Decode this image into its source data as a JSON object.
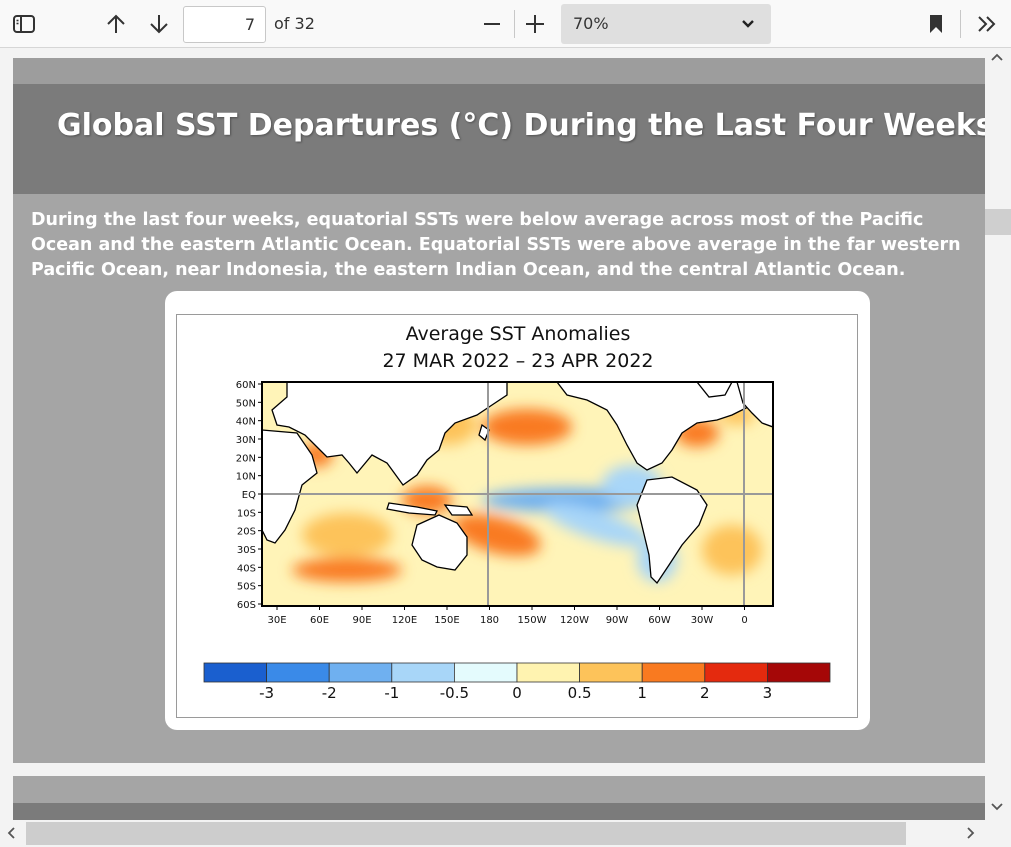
{
  "toolbar": {
    "page_current": "7",
    "page_total": "of 32",
    "zoom": "70%"
  },
  "slide": {
    "title": "Global SST Departures (°C) During the Last Four Weeks",
    "body": "During the last four weeks, equatorial SSTs were below average across most of the Pacific Ocean and the eastern Atlantic Ocean.  Equatorial SSTs were above average in the far western Pacific Ocean, near Indonesia, the eastern Indian Ocean, and the central Atlantic Ocean.",
    "map_title": "Average SST Anomalies",
    "map_dates": "27 MAR 2022 – 23 APR 2022",
    "lat_labels": [
      "60N",
      "50N",
      "40N",
      "30N",
      "20N",
      "10N",
      "EQ",
      "10S",
      "20S",
      "30S",
      "40S",
      "50S",
      "60S"
    ],
    "lon_labels": [
      "30E",
      "60E",
      "90E",
      "120E",
      "150E",
      "180",
      "150W",
      "120W",
      "90W",
      "60W",
      "30W",
      "0"
    ],
    "colorbar_labels": [
      "-3",
      "-2",
      "-1",
      "-0.5",
      "0",
      "0.5",
      "1",
      "2",
      "3"
    ],
    "colorbar_colors": [
      "#1a5fcf",
      "#3a8ae8",
      "#6fb0f0",
      "#a8d6f8",
      "#e4fbfd",
      "#fff3b0",
      "#fdc35a",
      "#f97a20",
      "#e42a0e",
      "#a50707"
    ]
  },
  "icons": {
    "sidebar": "sidebar-toggle-icon",
    "prev": "arrow-up-icon",
    "next": "arrow-down-icon",
    "zoom_out": "minus-icon",
    "zoom_in": "plus-icon",
    "bookmark": "bookmark-icon",
    "more": "double-chevron-right-icon"
  }
}
